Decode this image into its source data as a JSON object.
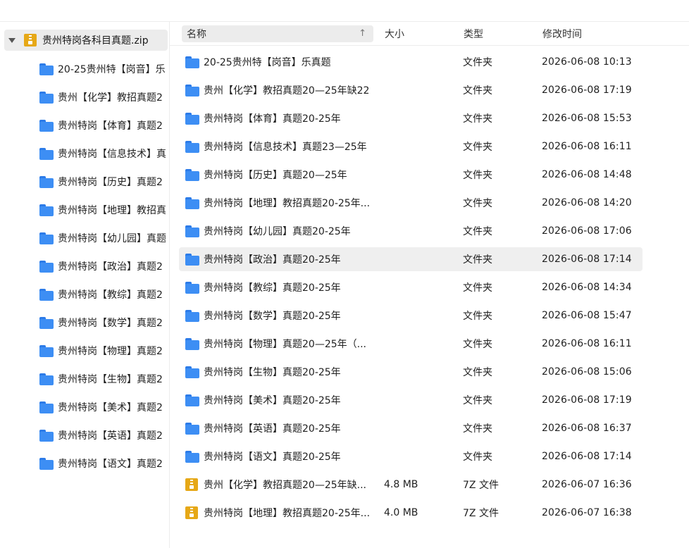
{
  "sidebar": {
    "root": {
      "label": "贵州特岗各科目真题.zip",
      "icon": "zip-archive-icon"
    },
    "items": [
      "20-25贵州特【岗音】乐",
      "贵州【化学】教招真题2",
      "贵州特岗【体育】真题2",
      "贵州特岗【信息技术】真",
      "贵州特岗【历史】真题2",
      "贵州特岗【地理】教招真",
      "贵州特岗【幼儿园】真题",
      "贵州特岗【政治】真题2",
      "贵州特岗【教综】真题2",
      "贵州特岗【数学】真题2",
      "贵州特岗【物理】真题2",
      "贵州特岗【生物】真题2",
      "贵州特岗【美术】真题2",
      "贵州特岗【英语】真题2",
      "贵州特岗【语文】真题2"
    ]
  },
  "columns": {
    "name": "名称",
    "size": "大小",
    "type": "类型",
    "modified": "修改时间"
  },
  "files": [
    {
      "name": "20-25贵州特【岗音】乐真题",
      "size": "",
      "type": "文件夹",
      "modified": "2026-06-08 10:13",
      "icon": "folder-icon"
    },
    {
      "name": "贵州【化学】教招真题20—25年缺22",
      "size": "",
      "type": "文件夹",
      "modified": "2026-06-08 17:19",
      "icon": "folder-icon"
    },
    {
      "name": "贵州特岗【体育】真题20-25年",
      "size": "",
      "type": "文件夹",
      "modified": "2026-06-08 15:53",
      "icon": "folder-icon"
    },
    {
      "name": "贵州特岗【信息技术】真题23—25年",
      "size": "",
      "type": "文件夹",
      "modified": "2026-06-08 16:11",
      "icon": "folder-icon"
    },
    {
      "name": "贵州特岗【历史】真题20—25年",
      "size": "",
      "type": "文件夹",
      "modified": "2026-06-08 14:48",
      "icon": "folder-icon"
    },
    {
      "name": "贵州特岗【地理】教招真题20-25年...",
      "size": "",
      "type": "文件夹",
      "modified": "2026-06-08 14:20",
      "icon": "folder-icon"
    },
    {
      "name": "贵州特岗【幼儿园】真题20-25年",
      "size": "",
      "type": "文件夹",
      "modified": "2026-06-08 17:06",
      "icon": "folder-icon"
    },
    {
      "name": "贵州特岗【政治】真题20-25年",
      "size": "",
      "type": "文件夹",
      "modified": "2026-06-08 17:14",
      "icon": "folder-icon",
      "selected": true
    },
    {
      "name": "贵州特岗【教综】真题20-25年",
      "size": "",
      "type": "文件夹",
      "modified": "2026-06-08 14:34",
      "icon": "folder-icon"
    },
    {
      "name": "贵州特岗【数学】真题20-25年",
      "size": "",
      "type": "文件夹",
      "modified": "2026-06-08 15:47",
      "icon": "folder-icon"
    },
    {
      "name": "贵州特岗【物理】真题20—25年（...",
      "size": "",
      "type": "文件夹",
      "modified": "2026-06-08 16:11",
      "icon": "folder-icon"
    },
    {
      "name": "贵州特岗【生物】真题20-25年",
      "size": "",
      "type": "文件夹",
      "modified": "2026-06-08 15:06",
      "icon": "folder-icon"
    },
    {
      "name": "贵州特岗【美术】真题20-25年",
      "size": "",
      "type": "文件夹",
      "modified": "2026-06-08 17:19",
      "icon": "folder-icon"
    },
    {
      "name": "贵州特岗【英语】真题20-25年",
      "size": "",
      "type": "文件夹",
      "modified": "2026-06-08 16:37",
      "icon": "folder-icon"
    },
    {
      "name": "贵州特岗【语文】真题20-25年",
      "size": "",
      "type": "文件夹",
      "modified": "2026-06-08 17:14",
      "icon": "folder-icon"
    },
    {
      "name": "贵州【化学】教招真题20—25年缺...",
      "size": "4.8 MB",
      "type": "7Z 文件",
      "modified": "2026-06-07 16:36",
      "icon": "zip-archive-icon"
    },
    {
      "name": "贵州特岗【地理】教招真题20-25年...",
      "size": "4.0 MB",
      "type": "7Z 文件",
      "modified": "2026-06-07 16:38",
      "icon": "zip-archive-icon"
    }
  ],
  "colors": {
    "folder": "#3d8ef4",
    "archive": "#e6a817",
    "selection": "#efefef",
    "header_active": "#ececec"
  }
}
